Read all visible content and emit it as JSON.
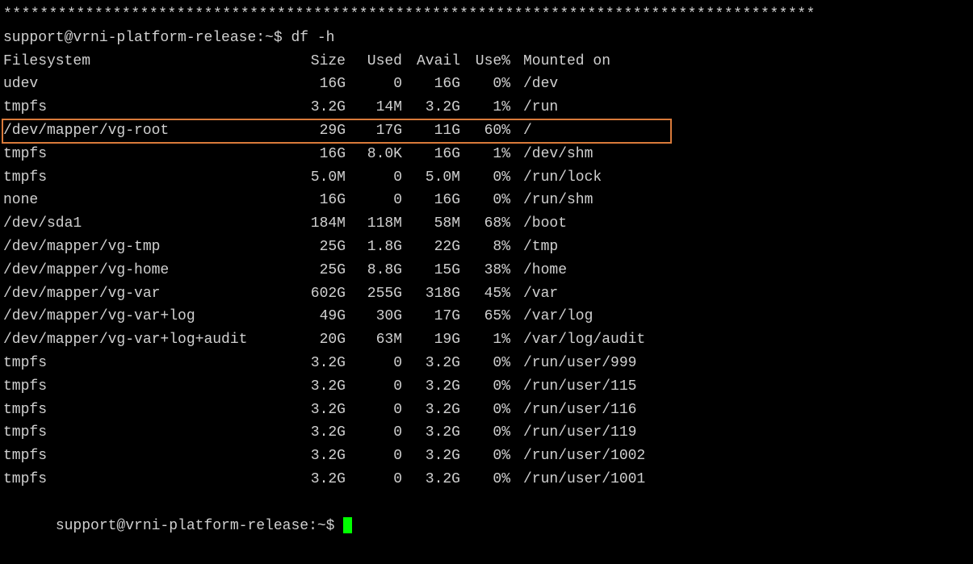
{
  "separator": "*****************************************************************************************",
  "prompt1": "support@vrni-platform-release:~$ df -h",
  "prompt2": "support@vrni-platform-release:~$ ",
  "headers": {
    "filesystem": "Filesystem",
    "size": "Size",
    "used": "Used",
    "avail": "Avail",
    "use": "Use%",
    "mount": "Mounted on"
  },
  "rows": [
    {
      "fs": "udev",
      "size": "16G",
      "used": "0",
      "avail": "16G",
      "use": "0%",
      "mount": "/dev",
      "hl": false
    },
    {
      "fs": "tmpfs",
      "size": "3.2G",
      "used": "14M",
      "avail": "3.2G",
      "use": "1%",
      "mount": "/run",
      "hl": false
    },
    {
      "fs": "/dev/mapper/vg-root",
      "size": "29G",
      "used": "17G",
      "avail": "11G",
      "use": "60%",
      "mount": "/",
      "hl": true
    },
    {
      "fs": "tmpfs",
      "size": "16G",
      "used": "8.0K",
      "avail": "16G",
      "use": "1%",
      "mount": "/dev/shm",
      "hl": false
    },
    {
      "fs": "tmpfs",
      "size": "5.0M",
      "used": "0",
      "avail": "5.0M",
      "use": "0%",
      "mount": "/run/lock",
      "hl": false
    },
    {
      "fs": "none",
      "size": "16G",
      "used": "0",
      "avail": "16G",
      "use": "0%",
      "mount": "/run/shm",
      "hl": false
    },
    {
      "fs": "/dev/sda1",
      "size": "184M",
      "used": "118M",
      "avail": "58M",
      "use": "68%",
      "mount": "/boot",
      "hl": false
    },
    {
      "fs": "/dev/mapper/vg-tmp",
      "size": "25G",
      "used": "1.8G",
      "avail": "22G",
      "use": "8%",
      "mount": "/tmp",
      "hl": false
    },
    {
      "fs": "/dev/mapper/vg-home",
      "size": "25G",
      "used": "8.8G",
      "avail": "15G",
      "use": "38%",
      "mount": "/home",
      "hl": false
    },
    {
      "fs": "/dev/mapper/vg-var",
      "size": "602G",
      "used": "255G",
      "avail": "318G",
      "use": "45%",
      "mount": "/var",
      "hl": false
    },
    {
      "fs": "/dev/mapper/vg-var+log",
      "size": "49G",
      "used": "30G",
      "avail": "17G",
      "use": "65%",
      "mount": "/var/log",
      "hl": false
    },
    {
      "fs": "/dev/mapper/vg-var+log+audit",
      "size": "20G",
      "used": "63M",
      "avail": "19G",
      "use": "1%",
      "mount": "/var/log/audit",
      "hl": false
    },
    {
      "fs": "tmpfs",
      "size": "3.2G",
      "used": "0",
      "avail": "3.2G",
      "use": "0%",
      "mount": "/run/user/999",
      "hl": false
    },
    {
      "fs": "tmpfs",
      "size": "3.2G",
      "used": "0",
      "avail": "3.2G",
      "use": "0%",
      "mount": "/run/user/115",
      "hl": false
    },
    {
      "fs": "tmpfs",
      "size": "3.2G",
      "used": "0",
      "avail": "3.2G",
      "use": "0%",
      "mount": "/run/user/116",
      "hl": false
    },
    {
      "fs": "tmpfs",
      "size": "3.2G",
      "used": "0",
      "avail": "3.2G",
      "use": "0%",
      "mount": "/run/user/119",
      "hl": false
    },
    {
      "fs": "tmpfs",
      "size": "3.2G",
      "used": "0",
      "avail": "3.2G",
      "use": "0%",
      "mount": "/run/user/1002",
      "hl": false
    },
    {
      "fs": "tmpfs",
      "size": "3.2G",
      "used": "0",
      "avail": "3.2G",
      "use": "0%",
      "mount": "/run/user/1001",
      "hl": false
    }
  ]
}
